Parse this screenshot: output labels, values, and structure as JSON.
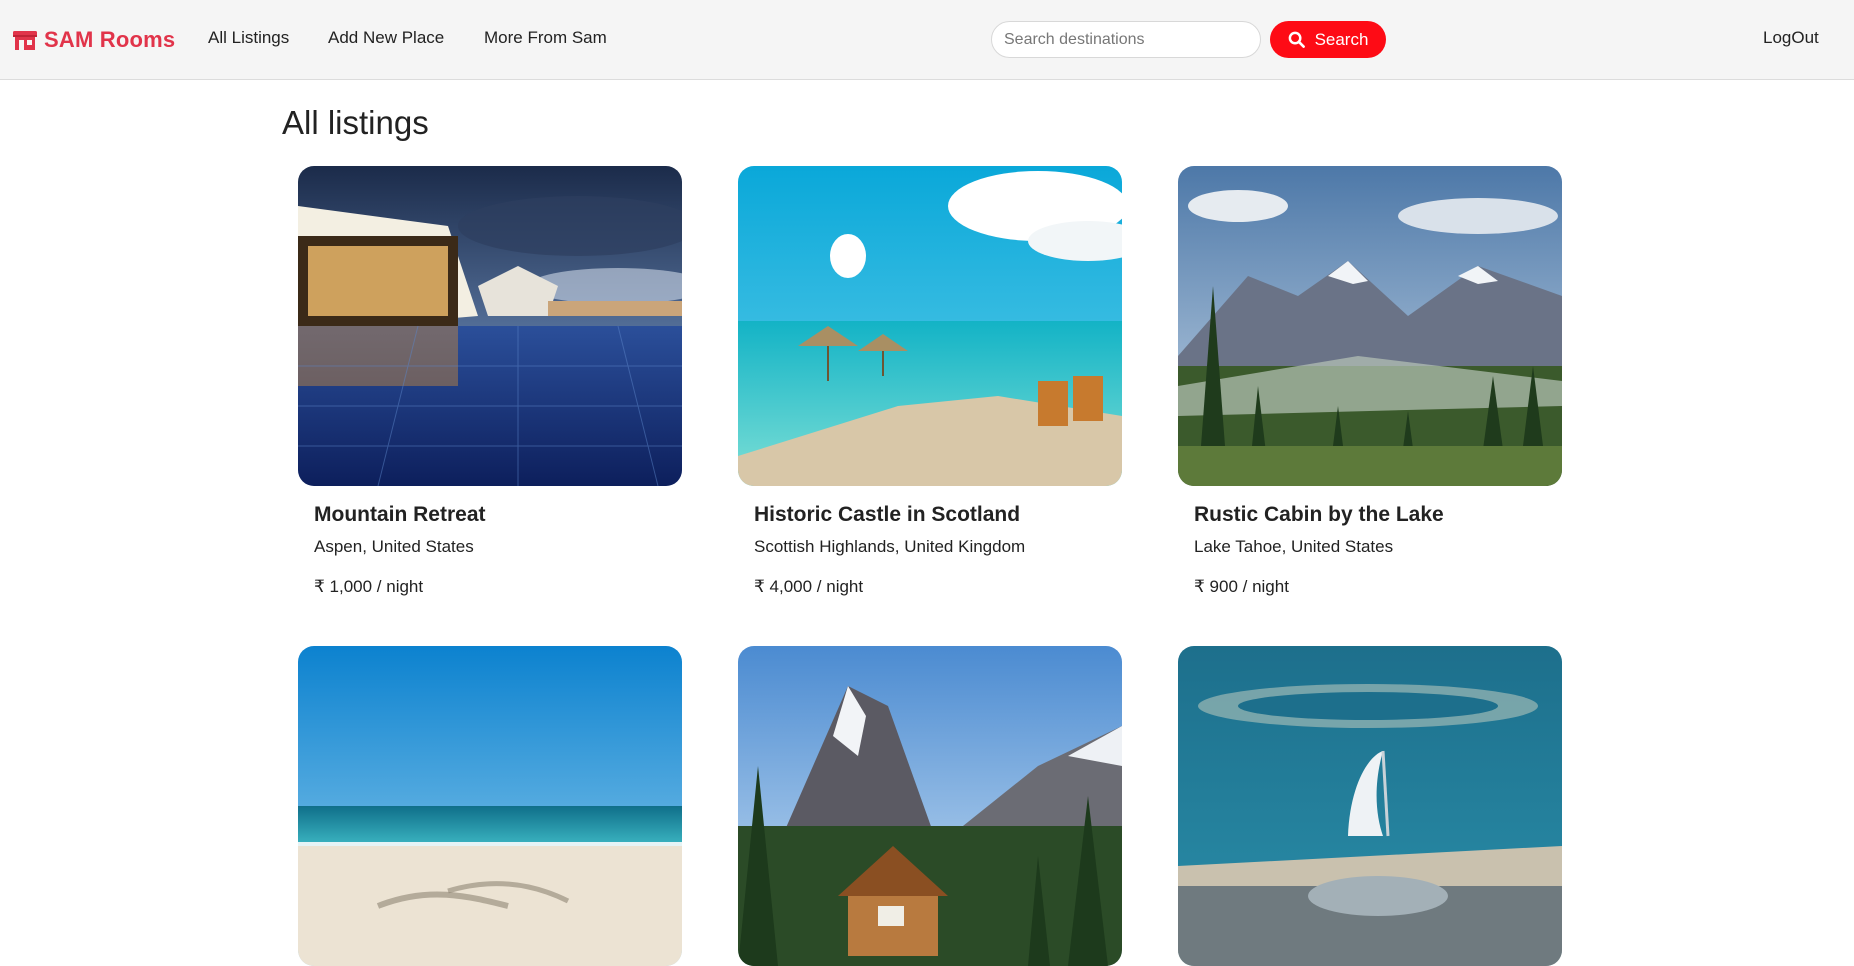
{
  "brand": {
    "name": "SAM Rooms",
    "icon": "storefront-icon",
    "color": "#e1344a"
  },
  "nav": {
    "all_listings": "All Listings",
    "add_new_place": "Add New Place",
    "more_from_sam": "More From Sam"
  },
  "search": {
    "placeholder": "Search destinations",
    "value": "",
    "button_label": "Search",
    "button_color": "#fe0b15"
  },
  "auth": {
    "logout_label": "LogOut"
  },
  "page": {
    "title": "All listings"
  },
  "listings": [
    {
      "title": "Mountain Retreat",
      "location": "Aspen, United States",
      "price": "₹ 1,000 / night",
      "image": "resort-pool-photo"
    },
    {
      "title": "Historic Castle in Scotland",
      "location": "Scottish Highlands, United Kingdom",
      "price": "₹ 4,000 / night",
      "image": "tropical-beach-photo"
    },
    {
      "title": "Rustic Cabin by the Lake",
      "location": "Lake Tahoe, United States",
      "price": "₹ 900 / night",
      "image": "mountain-valley-photo"
    },
    {
      "title": "",
      "location": "",
      "price": "",
      "image": "beach-palm-shadow-photo"
    },
    {
      "title": "",
      "location": "",
      "price": "",
      "image": "log-cabin-mountain-photo"
    },
    {
      "title": "",
      "location": "",
      "price": "",
      "image": "dubai-aerial-photo"
    }
  ]
}
